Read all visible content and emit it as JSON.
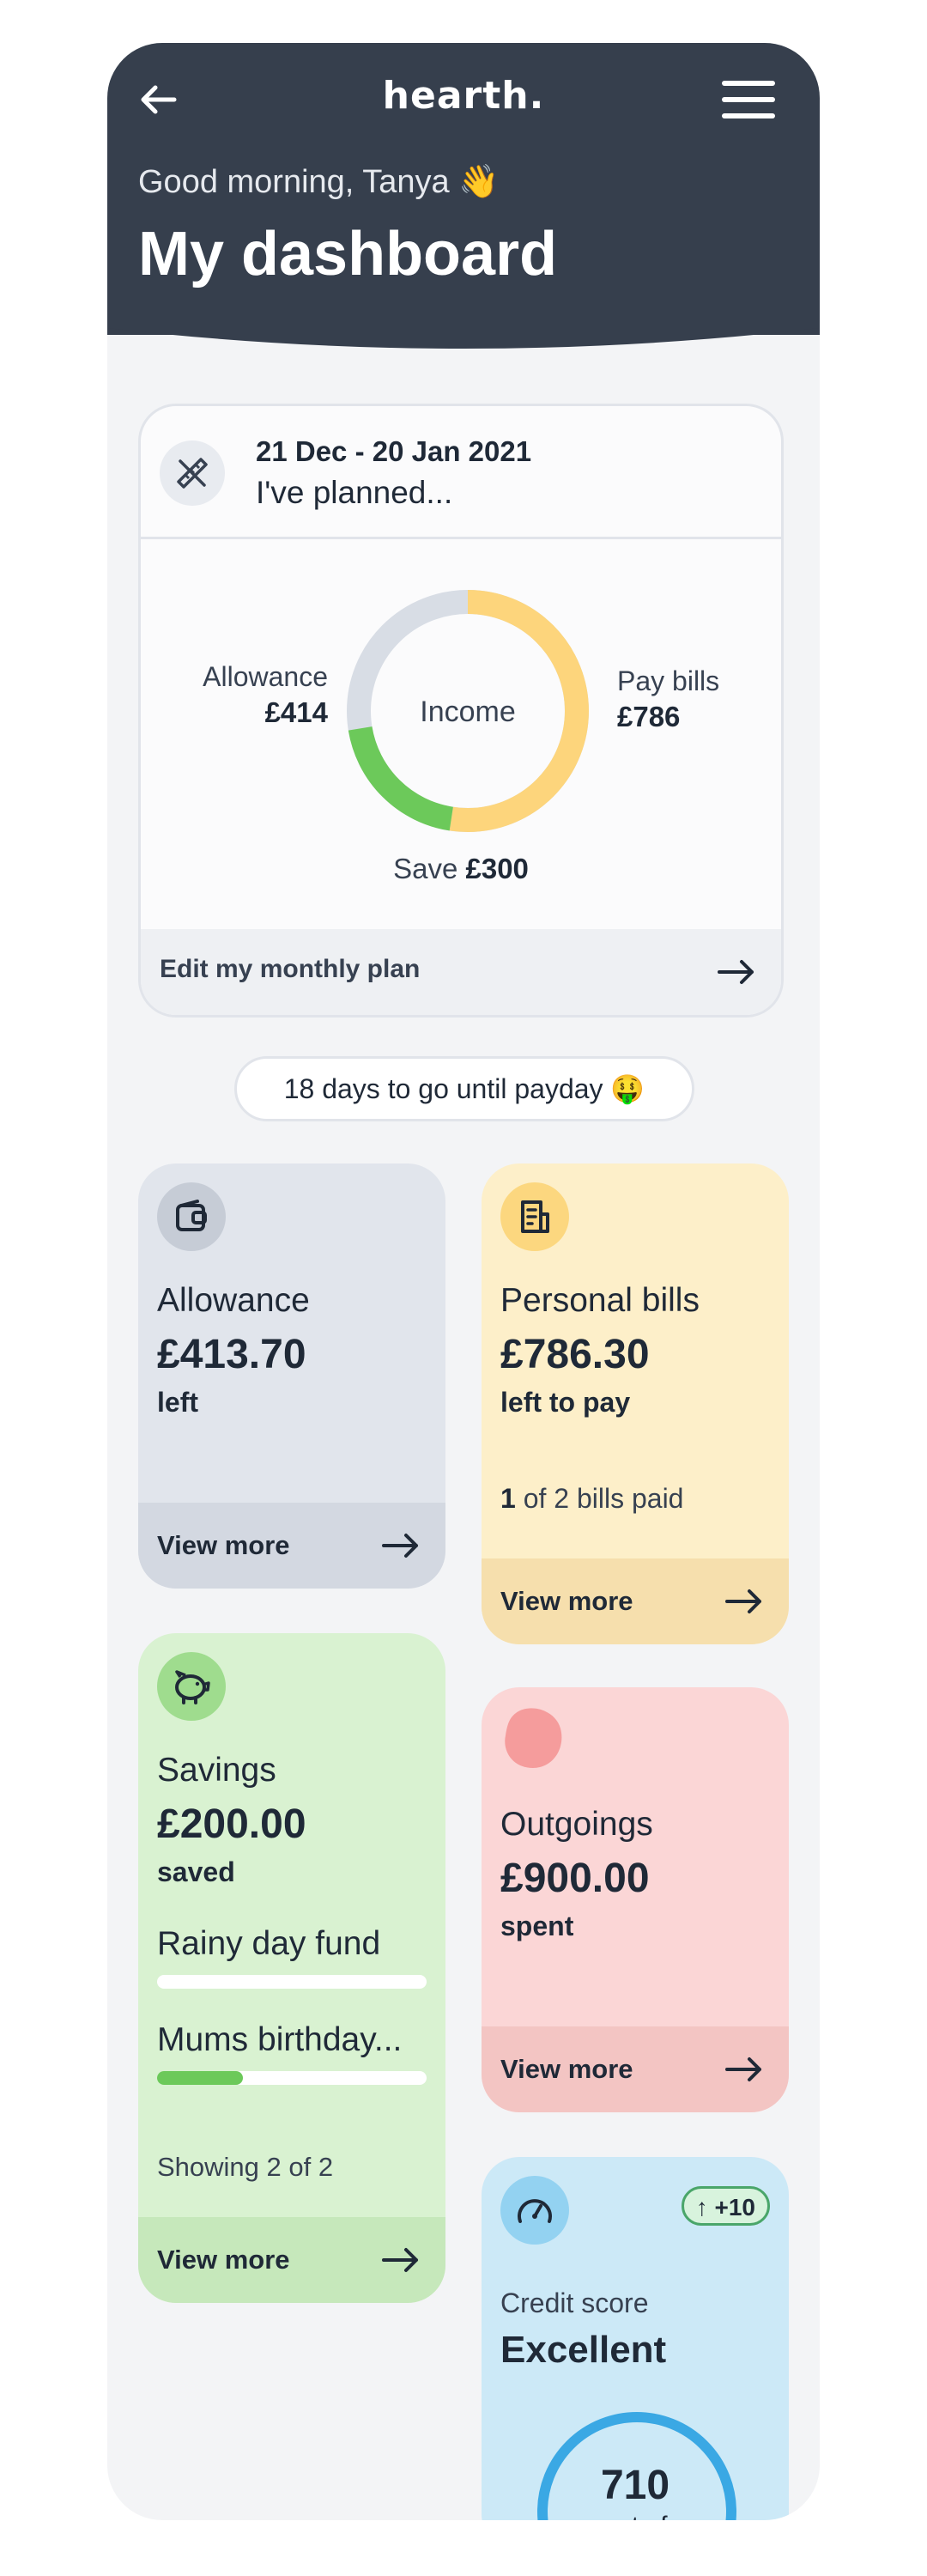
{
  "app": {
    "logo": "hearth.",
    "greeting": "Good morning, Tanya 👋",
    "title": "My dashboard"
  },
  "plan": {
    "date_range": "21 Dec - 20 Jan 2021",
    "subtitle": "I've planned...",
    "center_label": "Income",
    "allowance_label": "Allowance",
    "allowance_value": "£414",
    "bills_label": "Pay bills",
    "bills_value": "£786",
    "save_label": "Save",
    "save_value": "£300",
    "edit_label": "Edit my monthly plan"
  },
  "payday": "18 days to go until payday 🤑",
  "tiles": {
    "allowance": {
      "name": "Allowance",
      "amount": "£413.70",
      "sub": "left",
      "cta": "View more"
    },
    "bills": {
      "name": "Personal bills",
      "amount": "£786.30",
      "sub": "left to pay",
      "paid_count": "1",
      "paid_text": " of 2 bills paid",
      "cta": "View more"
    },
    "savings": {
      "name": "Savings",
      "amount": "£200.00",
      "sub": "saved",
      "goals": [
        {
          "name": "Rainy day fund",
          "progress": 0.0
        },
        {
          "name": "Mums birthday...",
          "progress": 0.32
        }
      ],
      "showing": "Showing 2 of 2",
      "cta": "View more"
    },
    "outgoings": {
      "name": "Outgoings",
      "amount": "£900.00",
      "sub": "spent",
      "cta": "View more"
    },
    "credit": {
      "label": "Credit score",
      "rating": "Excellent",
      "delta": "↑ +10",
      "score": "710",
      "out_of": "out of"
    }
  },
  "colors": {
    "header": "#363f4d",
    "allowance": "#e1e5ec",
    "bills": "#fdefc9",
    "savings": "#d9f2d1",
    "outgoings": "#fbd6d6",
    "credit": "#cce9f7",
    "donut_grey": "#d8dde5",
    "donut_yellow": "#fdd57c",
    "donut_green": "#6cc95a",
    "score_ring": "#3aa8e4"
  },
  "icons": [
    "back-arrow-icon",
    "hamburger-menu-icon",
    "ruler-pencil-icon",
    "wallet-icon",
    "bill-icon",
    "piggy-bank-icon",
    "outgoings-blob-icon",
    "speedometer-icon",
    "arrow-right-icon"
  ]
}
